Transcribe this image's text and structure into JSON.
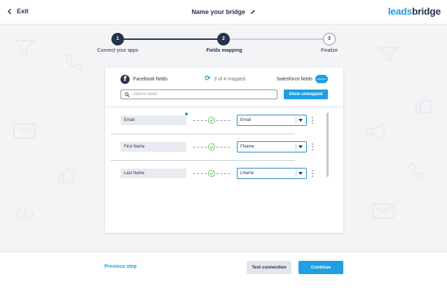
{
  "header": {
    "exit_label": "Exit",
    "bridge_title": "Name your bridge",
    "logo_part1": "leads",
    "logo_part2": "bridge"
  },
  "stepper": {
    "steps": [
      {
        "number": "1",
        "label": "Connect your apps",
        "state": "done"
      },
      {
        "number": "2",
        "label": "Fields mapping",
        "state": "active"
      },
      {
        "number": "3",
        "label": "Finalize",
        "state": "todo"
      }
    ]
  },
  "mapping": {
    "source_label": "Facebook fields",
    "source_icon": "facebook-icon",
    "mapped_status": "3 of 4 mapped",
    "destination_label": "Salesforce fields",
    "destination_icon": "salesforce-icon",
    "destination_icon_text": "salesforce",
    "search_placeholder": "Search fields",
    "show_unmapped_label": "Show unmapped",
    "rows": [
      {
        "source": "Email",
        "destination": "Email",
        "required": true
      },
      {
        "source": "First Name",
        "destination": "FName",
        "required": false
      },
      {
        "source": "Last Name",
        "destination": "LName",
        "required": false
      }
    ]
  },
  "footer": {
    "previous_label": "Previous step",
    "test_label": "Test connection",
    "continue_label": "Continue"
  },
  "colors": {
    "accent": "#1ea0e1",
    "dark": "#26334d",
    "success": "#66c26a"
  }
}
